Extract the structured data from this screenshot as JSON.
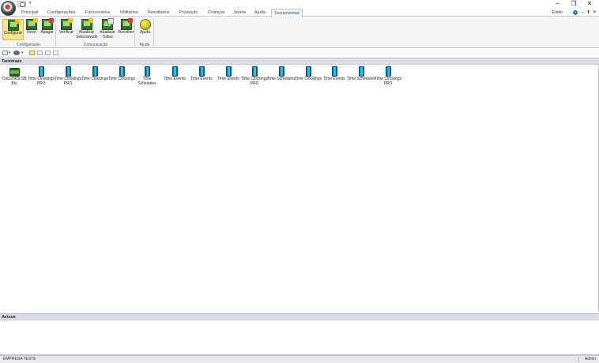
{
  "window": {
    "minimize": "–",
    "restore": "❐",
    "close": "✕"
  },
  "qat": {
    "dropdown": "▾"
  },
  "tabs": [
    {
      "label": "Principal"
    },
    {
      "label": "Configurações"
    },
    {
      "label": "Funcionários"
    },
    {
      "label": "Utilitários"
    },
    {
      "label": "Resultados"
    },
    {
      "label": "Produção"
    },
    {
      "label": "Crianças"
    },
    {
      "label": "Janela"
    },
    {
      "label": "Ajuda"
    },
    {
      "label": "Ferramentas"
    }
  ],
  "style_menu": "Estilo",
  "help_glyph": "?",
  "mini_controls": [
    "–",
    "⬆",
    "✕"
  ],
  "ribbon": {
    "groups": [
      {
        "label": "Configuração",
        "buttons": [
          {
            "label": "Configurar",
            "icon": "configure-icon",
            "selected": true
          },
          {
            "label": "Novo",
            "icon": "new-icon"
          },
          {
            "label": "Apagar",
            "icon": "delete-icon"
          }
        ]
      },
      {
        "label": "Comunicação",
        "buttons": [
          {
            "label": "Verificar",
            "icon": "verify-icon"
          },
          {
            "label": "Atualizar Selecionado",
            "icon": "update-selected-icon"
          },
          {
            "label": "Atualizar Todos",
            "icon": "update-all-icon"
          },
          {
            "label": "Recolher",
            "icon": "collect-icon"
          }
        ]
      },
      {
        "label": "Ajuda",
        "buttons": [
          {
            "label": "Ajuda",
            "icon": "help-icon"
          }
        ]
      }
    ]
  },
  "toolstrip": {
    "dropdown_glyph": "▾"
  },
  "terminals": {
    "header": "Terminais",
    "items": [
      {
        "label": "OutLock3LSB Bio",
        "icon": "biometric-reader-icon"
      },
      {
        "label": "Time Clockings PRO",
        "icon": "terminal-device-icon"
      },
      {
        "label": "Time Clockings PRO",
        "icon": "terminal-device-icon"
      },
      {
        "label": "Time Clockings",
        "icon": "terminal-device-icon"
      },
      {
        "label": "Time Clockings",
        "icon": "terminal-device-icon"
      },
      {
        "label": "Time Schedules",
        "icon": "terminal-device-icon"
      },
      {
        "label": "Time Events",
        "icon": "terminal-device-icon"
      },
      {
        "label": "Time Events",
        "icon": "terminal-device-icon"
      },
      {
        "label": "Time Events",
        "icon": "terminal-device-icon"
      },
      {
        "label": "Time Clockings PRO",
        "icon": "terminal-device-icon"
      },
      {
        "label": "Time Schedules",
        "icon": "terminal-device-icon"
      },
      {
        "label": "Time Clockings",
        "icon": "terminal-device-icon"
      },
      {
        "label": "Time Events",
        "icon": "terminal-device-icon"
      },
      {
        "label": "Time Schedules",
        "icon": "terminal-device-icon"
      },
      {
        "label": "Time Clockings PRO",
        "icon": "terminal-device-icon"
      }
    ]
  },
  "avisos": {
    "header": "Avisos"
  },
  "status": {
    "company": "EMPRESA TESTE",
    "user": "Admin"
  }
}
